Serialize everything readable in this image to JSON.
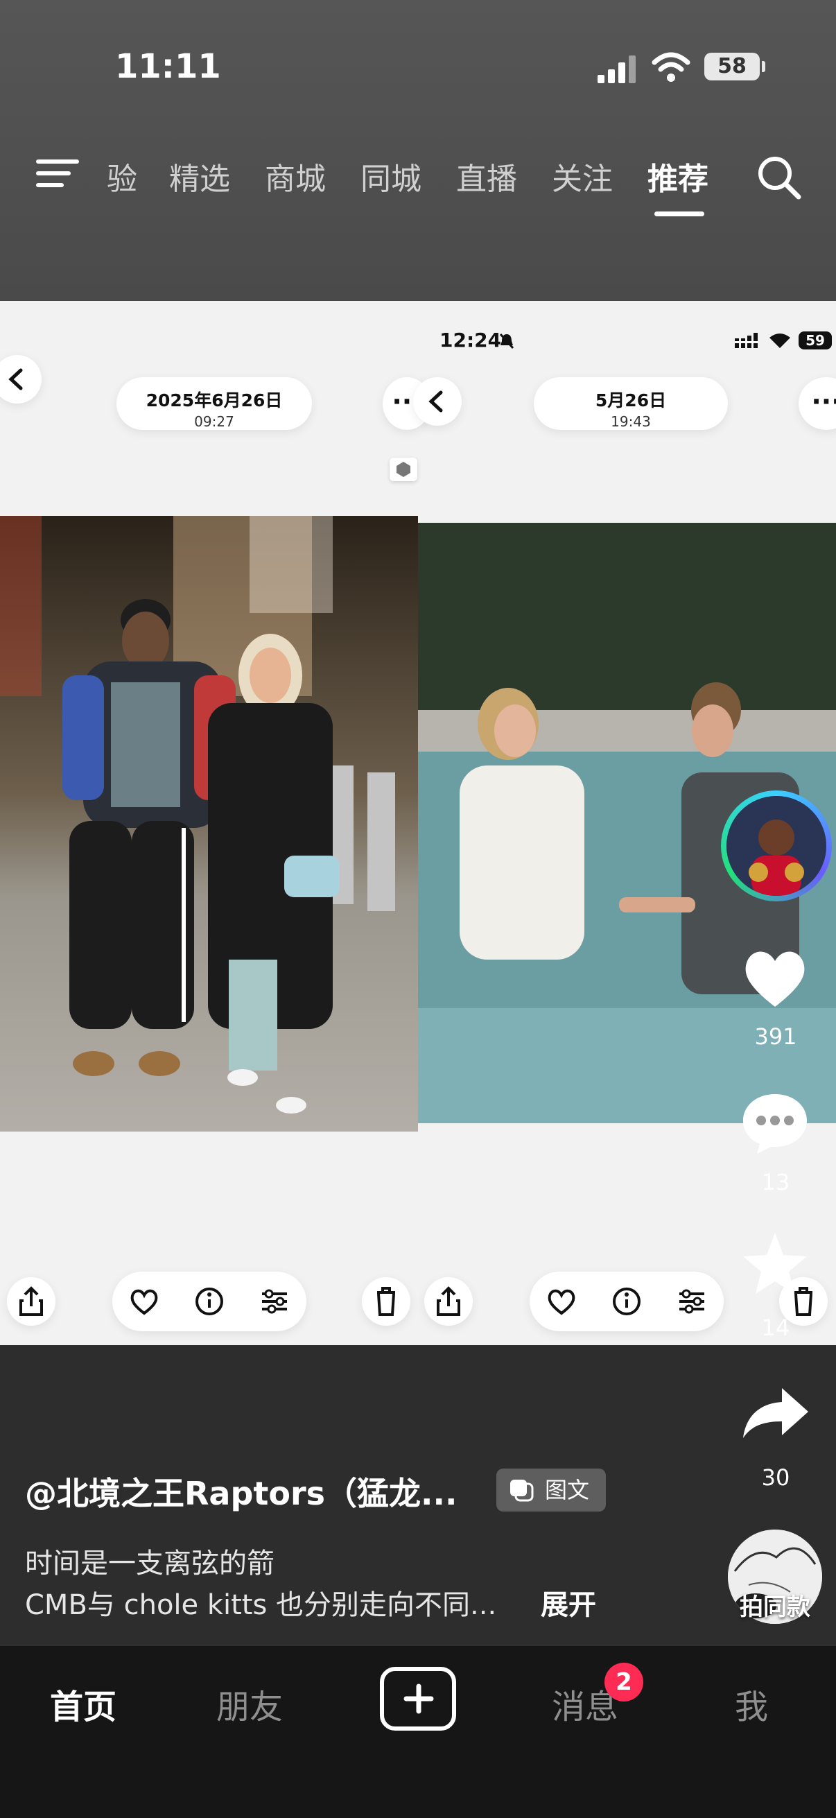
{
  "status_bar": {
    "time": "11:11",
    "battery": "58"
  },
  "top_tabs": {
    "items": [
      "验",
      "精选",
      "商城",
      "同城",
      "直播",
      "关注",
      "推荐"
    ],
    "active": "推荐"
  },
  "post": {
    "inner_status_time": "12:24",
    "inner_battery": "59",
    "left_card": {
      "date": "2025年6月26日",
      "time": "09:27"
    },
    "right_card": {
      "date": "5月26日",
      "time": "19:43"
    }
  },
  "actions": {
    "likes": "391",
    "comments": "13",
    "favorites": "14",
    "shares": "30",
    "same_style": "拍同款"
  },
  "caption": {
    "author": "@北境之王Raptors（猛龙...",
    "badge": "图文",
    "line1": "时间是一支离弦的箭",
    "line2": "CMB与 chole kitts 也分别走向不同...",
    "expand": "展开"
  },
  "bottom_nav": {
    "home": "首页",
    "friends": "朋友",
    "messages": "消息",
    "messages_badge": "2",
    "me": "我"
  },
  "colors": {
    "accent": "#fe2c55",
    "nav_bg": "#161616"
  }
}
